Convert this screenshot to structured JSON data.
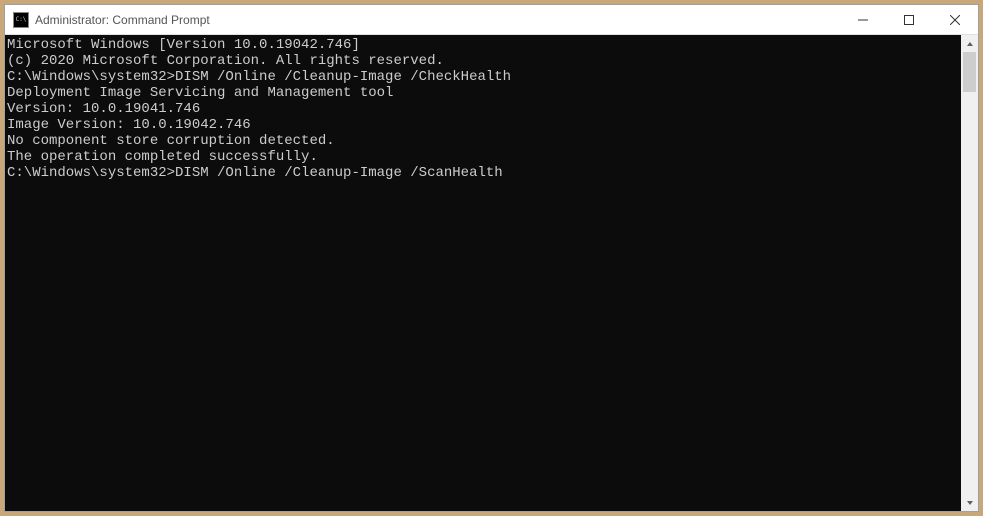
{
  "window": {
    "title": "Administrator: Command Prompt"
  },
  "terminal": {
    "lines": [
      "Microsoft Windows [Version 10.0.19042.746]",
      "(c) 2020 Microsoft Corporation. All rights reserved.",
      "",
      "C:\\Windows\\system32>DISM /Online /Cleanup-Image /CheckHealth",
      "",
      "Deployment Image Servicing and Management tool",
      "Version: 10.0.19041.746",
      "",
      "Image Version: 10.0.19042.746",
      "",
      "No component store corruption detected.",
      "The operation completed successfully.",
      "",
      "C:\\Windows\\system32>DISM /Online /Cleanup-Image /ScanHealth"
    ]
  }
}
